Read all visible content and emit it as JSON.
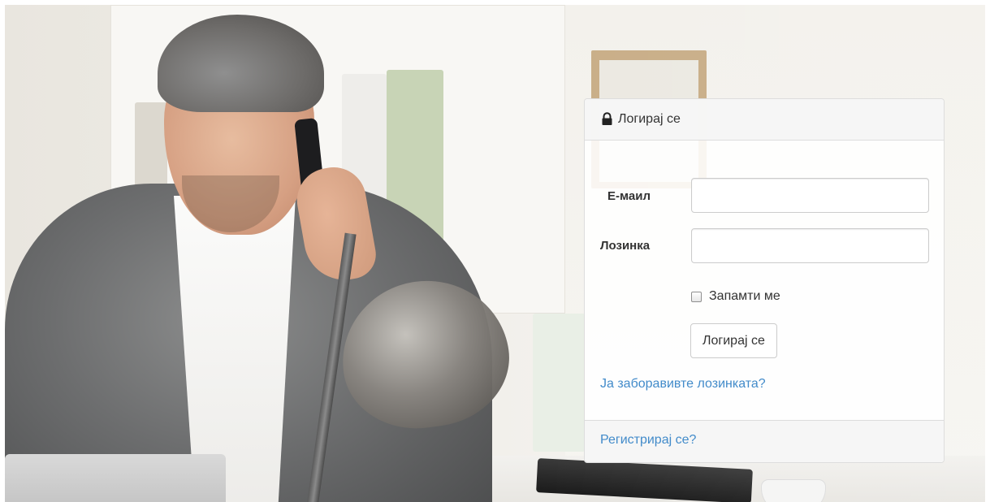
{
  "login_panel": {
    "title": "Логирај се",
    "title_icon": "lock-icon",
    "email_label": "Е-маил",
    "email_value": "",
    "password_label": "Лозинка",
    "password_value": "",
    "remember_label": "Запамти ме",
    "remember_checked": false,
    "submit_label": "Логирај се",
    "forgot_link": "Ја заборавивте лозинката?",
    "register_link": "Регистрирај се?"
  },
  "colors": {
    "link": "#428bca",
    "panel_border": "#dddddd",
    "heading_bg": "#f5f5f5",
    "text": "#333333"
  }
}
